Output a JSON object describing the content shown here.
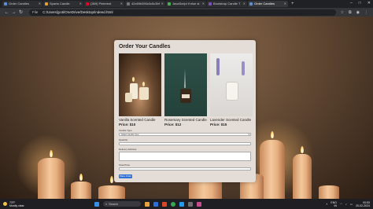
{
  "browser": {
    "tabs": [
      {
        "label": "Order Candles",
        "active": false,
        "color": "#5f8dd3"
      },
      {
        "label": "Sparta Candle",
        "active": false,
        "color": "#e0a030"
      },
      {
        "label": "(369) Pinterest",
        "active": false,
        "color": "#e60023"
      },
      {
        "label": "42c69b390c0c5c3bf",
        "active": false,
        "color": "#777777"
      },
      {
        "label": "JavaScript if else st",
        "active": false,
        "color": "#4caf50"
      },
      {
        "label": "Bootstrap Candle T",
        "active": false,
        "color": "#7952b3"
      },
      {
        "label": "Order Candles",
        "active": true,
        "color": "#5f8dd3"
      }
    ],
    "new_tab": "+",
    "window_controls": [
      "–",
      "□",
      "✕"
    ],
    "address_label": "File",
    "url": "C:/Users/jyoti/OneDrive/Desktop/indeed.html"
  },
  "page": {
    "title": "Order Your Candles",
    "products": [
      {
        "name": "Vanilla Scented Candle",
        "price": "Price: $10"
      },
      {
        "name": "Rosemary Scented Candle",
        "price": "Price: $12"
      },
      {
        "name": "Lavender Scented Candle",
        "price": "Price: $15"
      }
    ],
    "form": {
      "candle_type_label": "Candle Type",
      "candle_type_value": "Select Candle Type",
      "quantity_label": "Quantity",
      "delivery_label": "Delivery Address",
      "total_label": "Total Price",
      "submit_label": "Place Order"
    }
  },
  "taskbar": {
    "weather_temp": "73°F",
    "weather_desc": "Mostly clear",
    "search_placeholder": "Search",
    "language": "ENG",
    "region": "IN",
    "time": "00:53",
    "date": "20-02-2024",
    "accent": "#2e6fd8"
  }
}
